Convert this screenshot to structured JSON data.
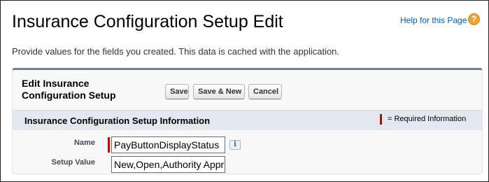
{
  "header": {
    "title": "Insurance Configuration Setup Edit",
    "help_link": "Help for this Page",
    "help_icon": "question-mark-icon",
    "help_icon_glyph": "?"
  },
  "intro": "Provide values for the fields you created. This data is cached with the application.",
  "panel": {
    "title": "Edit Insurance Configuration Setup",
    "buttons": {
      "save": "Save",
      "save_new": "Save & New",
      "cancel": "Cancel"
    },
    "section": {
      "title": "Insurance Configuration Setup Information",
      "required_legend": "= Required Information"
    },
    "fields": [
      {
        "label": "Name",
        "value": "PayButtonDisplayStatus",
        "required": true
      },
      {
        "label": "Setup Value",
        "value": "New,Open,Authority Approved",
        "required": false
      }
    ],
    "info_icon": "info-icon",
    "info_icon_glyph": "i"
  },
  "colors": {
    "link": "#015ba7",
    "help_icon": "#e7a23a",
    "required": "#c00000",
    "panel_border": "#747e96",
    "section_header": "#e3e8f0"
  }
}
